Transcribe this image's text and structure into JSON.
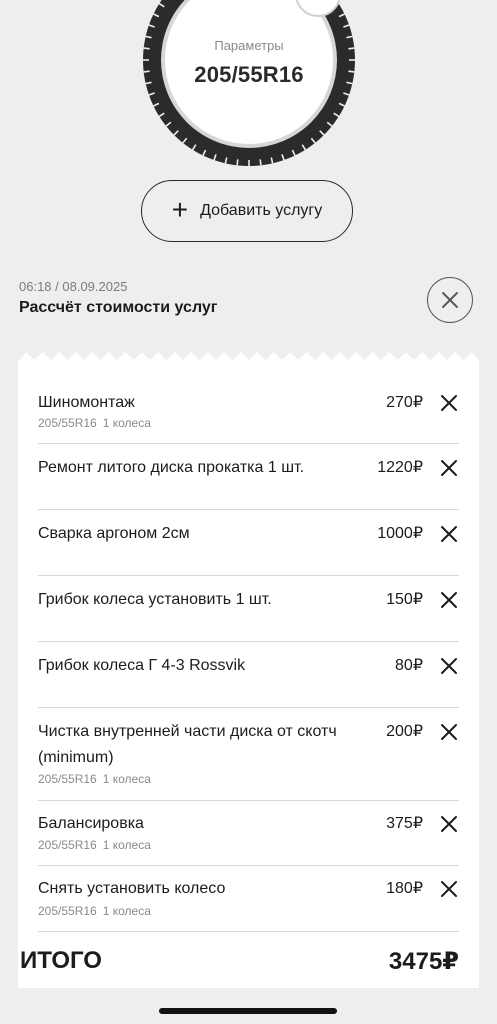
{
  "tire": {
    "params_label": "Параметры",
    "params_value": "205/55R16"
  },
  "add_service_label": "Добавить услугу",
  "calc": {
    "datetime": "06:18 / 08.09.2025",
    "title": "Рассчёт стоимости услуг"
  },
  "items": [
    {
      "name": "Шиномонтаж",
      "price": "270₽",
      "size": "205/55R16",
      "qty": "1 колеса"
    },
    {
      "name": "Ремонт литого диска прокатка 1 шт.",
      "price": "1220₽"
    },
    {
      "name": "Сварка аргоном 2см",
      "price": "1000₽"
    },
    {
      "name": "Грибок колеса установить 1 шт.",
      "price": "150₽"
    },
    {
      "name": "Грибок колеса Г 4-3 Rossvik",
      "price": "80₽"
    },
    {
      "name": "Чистка внутренней части диска от скотч (minimum)",
      "price": "200₽",
      "size": "205/55R16",
      "qty": "1 колеса"
    },
    {
      "name": "Балансировка",
      "price": "375₽",
      "size": "205/55R16",
      "qty": "1 колеса"
    },
    {
      "name": "Снять установить колесо",
      "price": "180₽",
      "size": "205/55R16",
      "qty": "1 колеса"
    }
  ],
  "total": {
    "label": "ИТОГО",
    "value": "3475₽"
  },
  "colors": {
    "background": "#eeeeee",
    "receipt": "#ffffff",
    "tire": "#2b2b2b",
    "text": "#1c1c1c",
    "muted": "#8a8a8a"
  }
}
